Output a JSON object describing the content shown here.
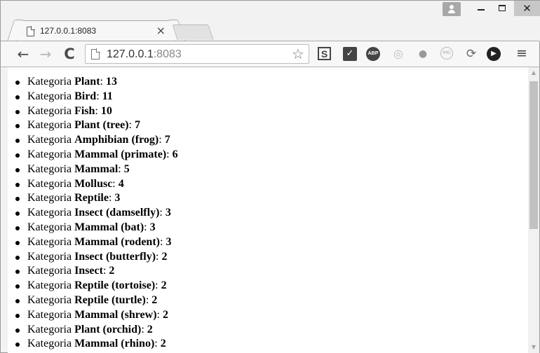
{
  "tab": {
    "title": "127.0.0.1:8083",
    "close_glyph": "×"
  },
  "window_controls": {
    "close_glyph": "✕"
  },
  "toolbar": {
    "back_glyph": "←",
    "forward_glyph": "→",
    "reload_glyph": "C",
    "url_host": "127.0.0.1",
    "url_port": ":8083",
    "star_glyph": "☆",
    "ext_s_label": "S",
    "ext_check_label": "✓",
    "ext_abp_label": "ABP",
    "menu_glyph": "≡"
  },
  "content": {
    "prefix": "Kategoria",
    "items": [
      {
        "name": "Plant",
        "count": "13"
      },
      {
        "name": "Bird",
        "count": "11"
      },
      {
        "name": "Fish",
        "count": "10"
      },
      {
        "name": "Plant (tree)",
        "count": "7"
      },
      {
        "name": "Amphibian (frog)",
        "count": "7"
      },
      {
        "name": "Mammal (primate)",
        "count": "6"
      },
      {
        "name": "Mammal",
        "count": "5"
      },
      {
        "name": "Mollusc",
        "count": "4"
      },
      {
        "name": "Reptile",
        "count": "3"
      },
      {
        "name": "Insect (damselfly)",
        "count": "3"
      },
      {
        "name": "Mammal (bat)",
        "count": "3"
      },
      {
        "name": "Mammal (rodent)",
        "count": "3"
      },
      {
        "name": "Insect (butterfly)",
        "count": "2"
      },
      {
        "name": "Insect",
        "count": "2"
      },
      {
        "name": "Reptile (tortoise)",
        "count": "2"
      },
      {
        "name": "Reptile (turtle)",
        "count": "2"
      },
      {
        "name": "Mammal (shrew)",
        "count": "2"
      },
      {
        "name": "Plant (orchid)",
        "count": "2"
      },
      {
        "name": "Mammal (rhino)",
        "count": "2"
      }
    ]
  },
  "scrollbar": {
    "thumb_fraction": 0.56
  }
}
